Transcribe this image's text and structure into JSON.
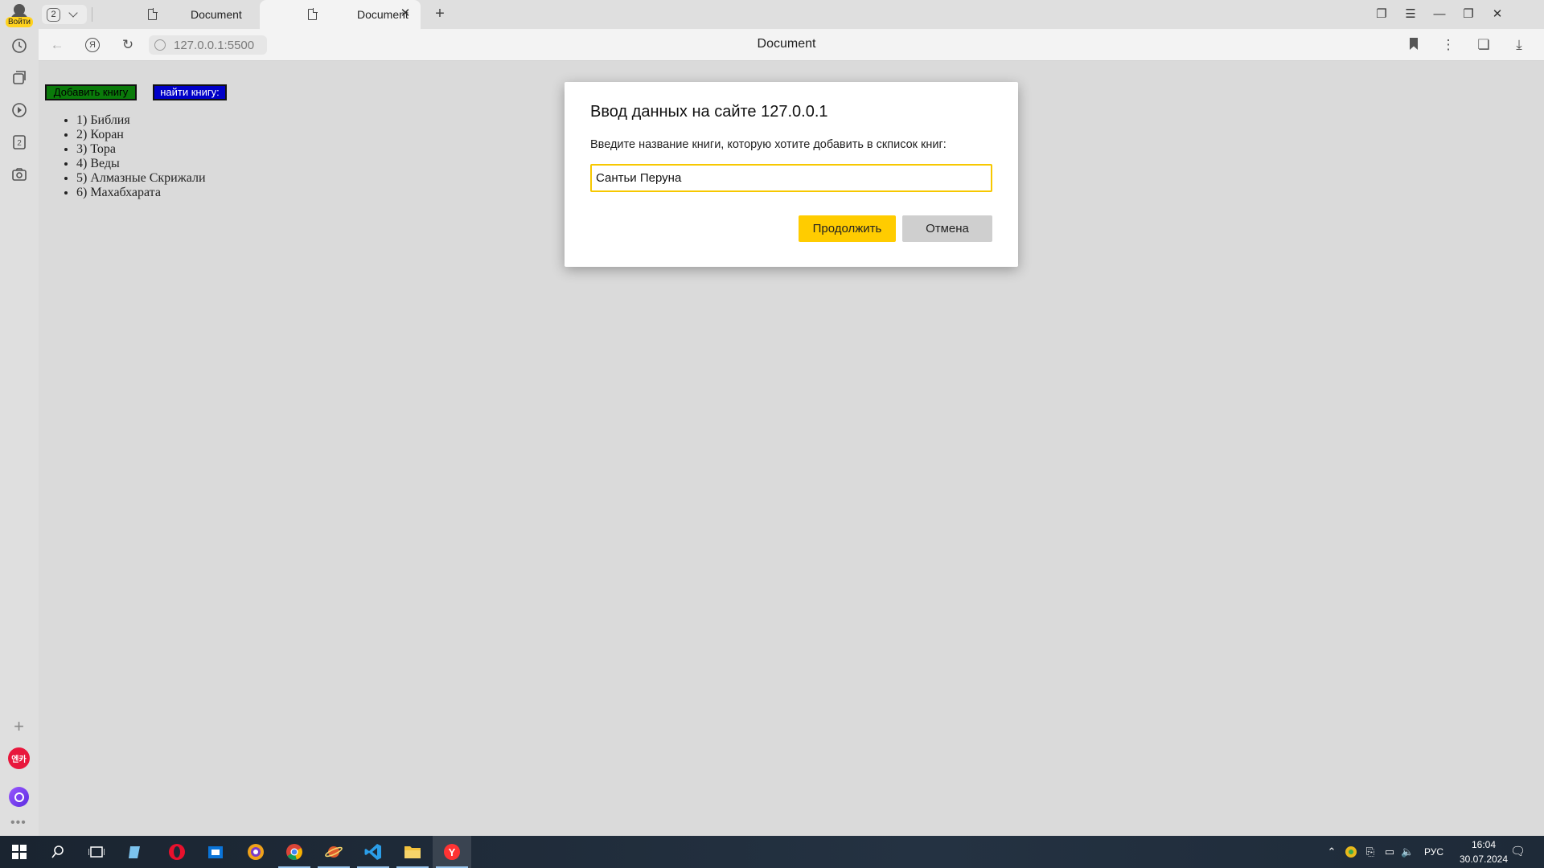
{
  "sidebar": {
    "login_label": "Войти",
    "tabs_count_badge": "2",
    "app_badge_label": "엔카"
  },
  "tabs": {
    "counter": "2",
    "items": [
      {
        "label": "Document",
        "active": false
      },
      {
        "label": "Document",
        "active": true
      }
    ]
  },
  "toolbar": {
    "url": "127.0.0.1:5500",
    "page_title": "Document"
  },
  "page": {
    "add_button": "Добавить книгу",
    "find_button": "найти книгу:",
    "books": [
      "1) Библия",
      "2) Коран",
      "3) Тора",
      "4) Веды",
      "5) Алмазные Скрижали",
      "6) Махабхарата"
    ]
  },
  "dialog": {
    "title": "Ввод данных на сайте 127.0.0.1",
    "message": "Введите название книги, которую хотите добавить в скписок книг:",
    "input_value": "Сантьи Перуна",
    "ok_label": "Продолжить",
    "cancel_label": "Отмена"
  },
  "taskbar": {
    "language": "РУС",
    "time": "16:04",
    "date": "30.07.2024"
  },
  "colors": {
    "accent": "#ffcc00",
    "add_button_bg": "#0a7a0a",
    "find_button_bg": "#0000c8"
  }
}
